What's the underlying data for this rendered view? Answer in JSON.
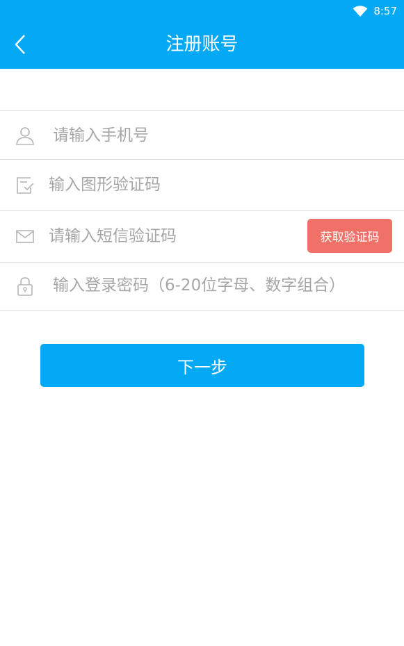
{
  "status_bar": {
    "time": "8:57",
    "wifi_icon": "wifi-icon"
  },
  "header": {
    "title": "注册账号",
    "back_icon": "chevron-left-icon",
    "color": "#03a9f4"
  },
  "form": {
    "phone": {
      "placeholder": "请输入手机号",
      "icon": "user-icon"
    },
    "captcha": {
      "placeholder": "输入图形验证码",
      "icon": "check-box-icon"
    },
    "sms_code": {
      "placeholder": "请输入短信验证码",
      "icon": "envelope-icon",
      "button_label": "获取验证码",
      "button_color": "#f07167"
    },
    "password": {
      "placeholder": "输入登录密码（6-20位字母、数字组合）",
      "icon": "lock-icon"
    }
  },
  "next_button": {
    "label": "下一步"
  }
}
